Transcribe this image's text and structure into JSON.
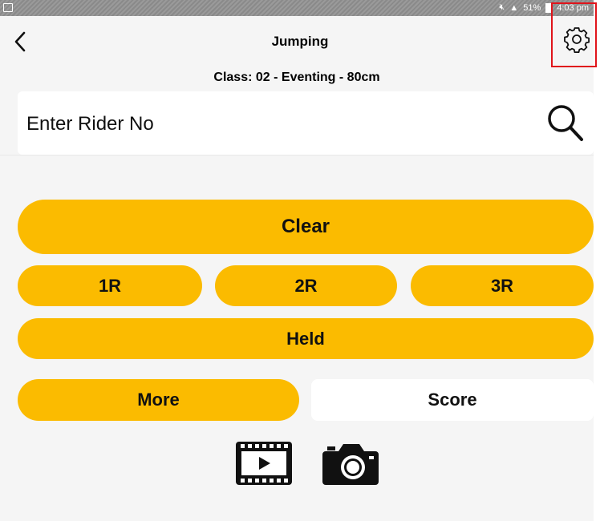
{
  "status_bar": {
    "battery": "51%",
    "time": "4:03 pm",
    "left_icon": "image-icon",
    "right_icons": [
      "mute-icon",
      "lte-signal-icon",
      "battery-icon"
    ]
  },
  "header": {
    "title": "Jumping",
    "subtitle": "Class: 02 - Eventing - 80cm",
    "back_icon": "chevron-left-icon",
    "settings_icon": "gear-icon",
    "settings_highlight_color": "#e0141b"
  },
  "search": {
    "placeholder": "Enter Rider No",
    "icon": "search-icon"
  },
  "actions": {
    "clear": "Clear",
    "one_r": "1R",
    "two_r": "2R",
    "three_r": "3R",
    "held": "Held",
    "more": "More",
    "score": "Score"
  },
  "media": {
    "video_icon": "video-play-icon",
    "camera_icon": "camera-icon"
  },
  "colors": {
    "accent": "#fbbb00",
    "background": "#f5f5f5",
    "card": "#ffffff"
  }
}
